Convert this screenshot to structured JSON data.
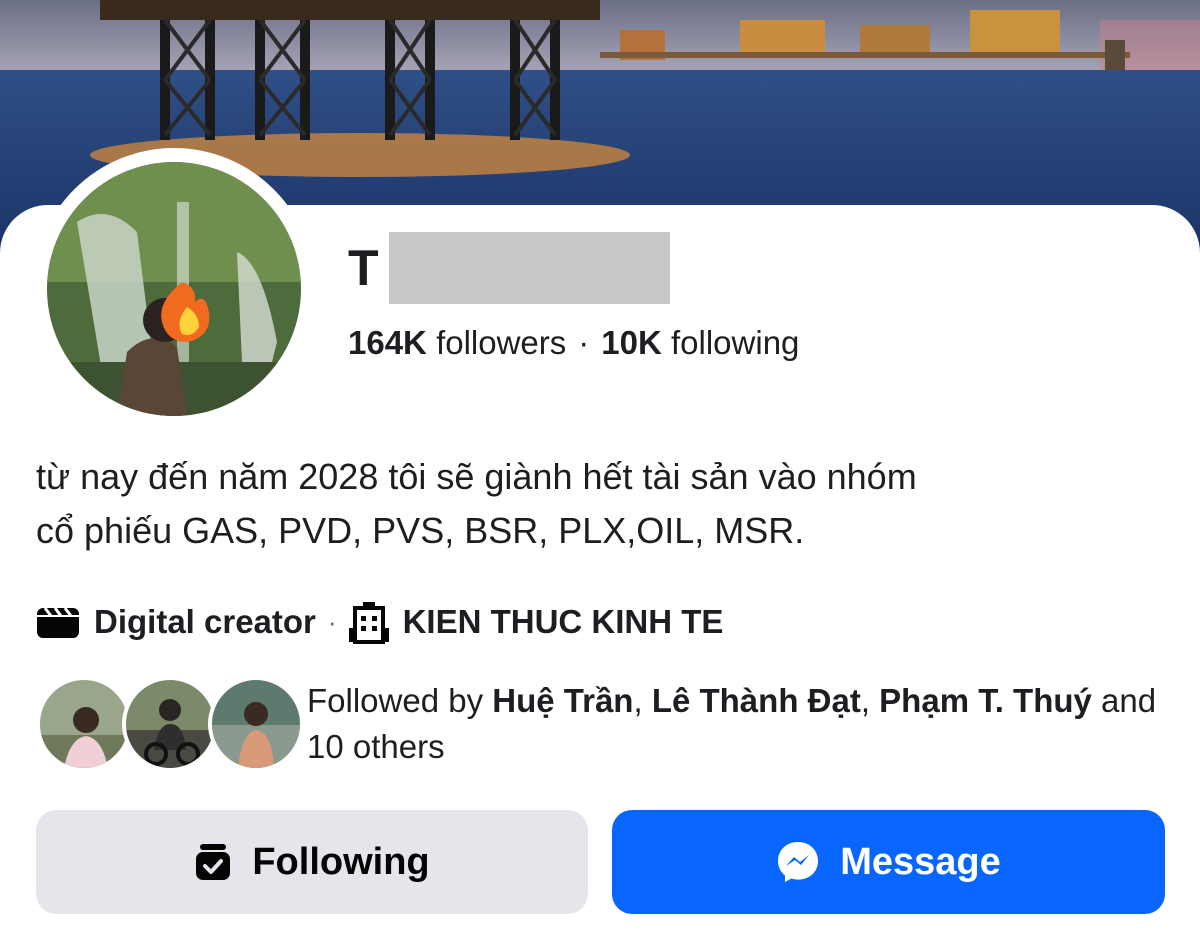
{
  "profile": {
    "name_visible": "T",
    "followers_count": "164K",
    "followers_label": "followers",
    "stats_separator": "·",
    "following_count": "10K",
    "following_label": "following",
    "bio_line1": "từ nay đến năm 2028 tôi sẽ giành hết tài sản vào nhóm",
    "bio_line2": "cổ phiếu GAS, PVD, PVS, BSR, PLX,OIL, MSR.",
    "category": "Digital creator",
    "meta_separator": "·",
    "page_link": "KIEN THUC KINH TE"
  },
  "mutuals": {
    "prefix": "Followed by",
    "names": [
      "Huệ Trần",
      "Lê Thành Đạt",
      "Phạm T. Thuý"
    ],
    "comma": ",",
    "suffix": "and 10 others"
  },
  "actions": {
    "following_label": "Following",
    "message_label": "Message"
  },
  "icons": {
    "category": "clapperboard-icon",
    "page": "building-icon",
    "following": "inbox-check-icon",
    "message": "messenger-icon"
  },
  "colors": {
    "message_button": "#0866ff",
    "following_button": "#e4e6eb",
    "redaction": "#c8c8c8"
  }
}
